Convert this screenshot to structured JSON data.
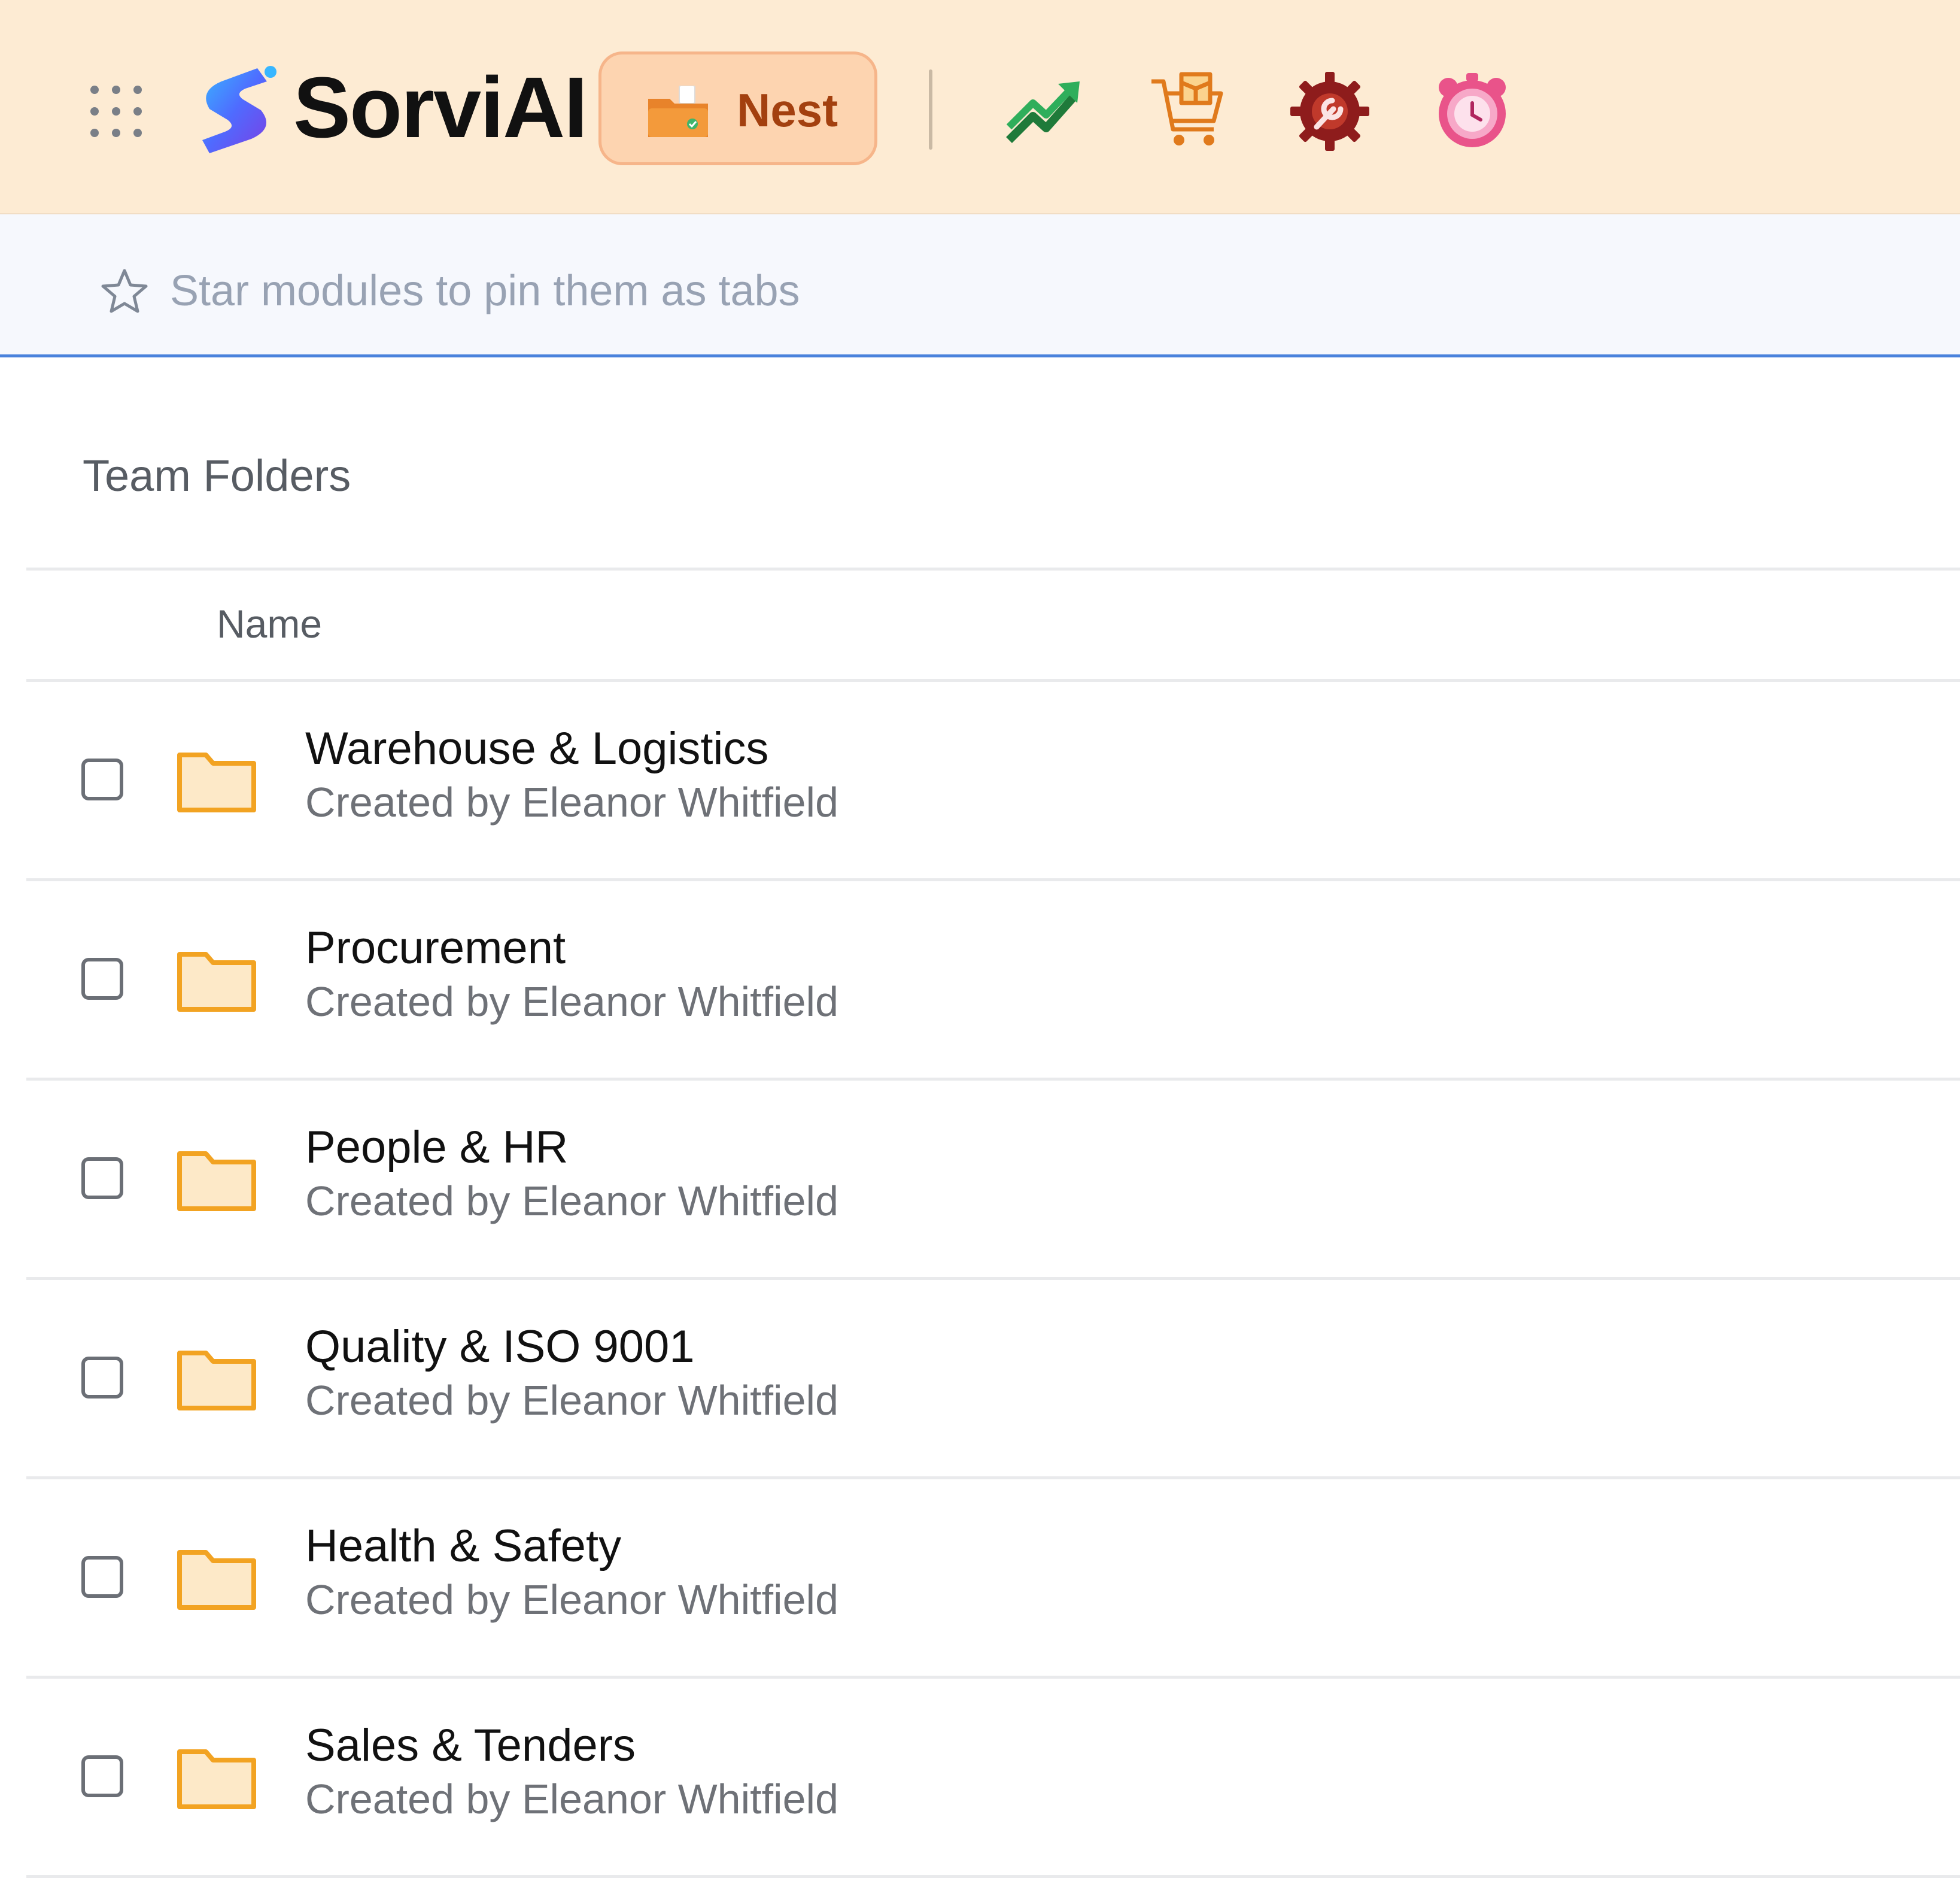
{
  "header": {
    "brand": "SorviAI",
    "active_app_label": "Nest",
    "modules": [
      {
        "icon": "trending-up-icon"
      },
      {
        "icon": "shopping-cart-box-icon"
      },
      {
        "icon": "gear-wrench-icon"
      },
      {
        "icon": "alarm-clock-icon"
      }
    ]
  },
  "pinbar": {
    "hint": "Star modules to pin them as tabs"
  },
  "main": {
    "section_title": "Team Folders",
    "columns": {
      "name": "Name"
    },
    "folders": [
      {
        "name": "Warehouse & Logistics",
        "created_by": "Created by Eleanor Whitfield"
      },
      {
        "name": "Procurement",
        "created_by": "Created by Eleanor Whitfield"
      },
      {
        "name": "People & HR",
        "created_by": "Created by Eleanor Whitfield"
      },
      {
        "name": "Quality & ISO 9001",
        "created_by": "Created by Eleanor Whitfield"
      },
      {
        "name": "Health & Safety",
        "created_by": "Created by Eleanor Whitfield"
      },
      {
        "name": "Sales & Tenders",
        "created_by": "Created by Eleanor Whitfield"
      }
    ]
  },
  "colors": {
    "topbar_bg": "#fdebd3",
    "nest_button_bg": "#fdd4b0",
    "nest_label": "#a3400f",
    "accent_line": "#4a82dc",
    "folder_stroke": "#f2a322",
    "folder_fill": "#fde9c8"
  }
}
